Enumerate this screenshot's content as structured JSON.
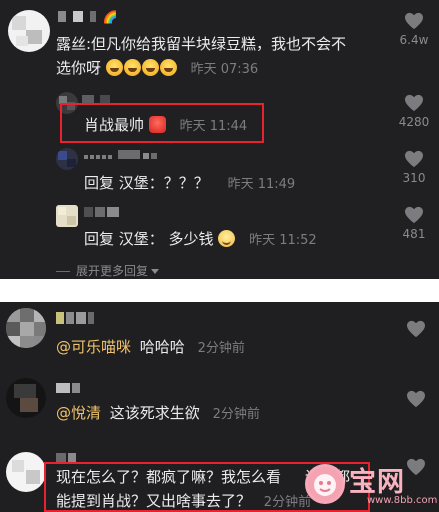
{
  "top_comment": {
    "name": "🌈",
    "text_line1": "露丝:但凡你给我留半块绿豆糕，我也不会不",
    "text_line2": "选你呀",
    "time": "昨天 07:36",
    "likes": "6.4w"
  },
  "reply1": {
    "text": "肖战最帅",
    "time": "昨天 11:44",
    "likes": "4280"
  },
  "reply2": {
    "text": "回复 汉堡：？？？",
    "time": "昨天 11:49",
    "likes": "310"
  },
  "reply3": {
    "text": "回复 汉堡： 多少钱",
    "time": "昨天 11:52",
    "likes": "481"
  },
  "expand_label": "展开更多回复",
  "comment_a": {
    "mention": "@可乐喵咪",
    "text": "哈哈哈",
    "time": "2分钟前"
  },
  "comment_b": {
    "mention": "@悅清",
    "text": "这该死求生欲",
    "time": "2分钟前"
  },
  "comment_c": {
    "text_line1": "现在怎么了？都疯了嘛？我怎么看",
    "text_line1_tail": "评论都",
    "text_line2": "能提到肖战？又出啥事去了？",
    "time": "2分钟前"
  },
  "watermark": {
    "text": "宝网",
    "url": "www.8bb.com"
  },
  "colors": {
    "panel_bg": "#202022",
    "highlight": "#e8222e",
    "mention": "#f0c36a"
  }
}
